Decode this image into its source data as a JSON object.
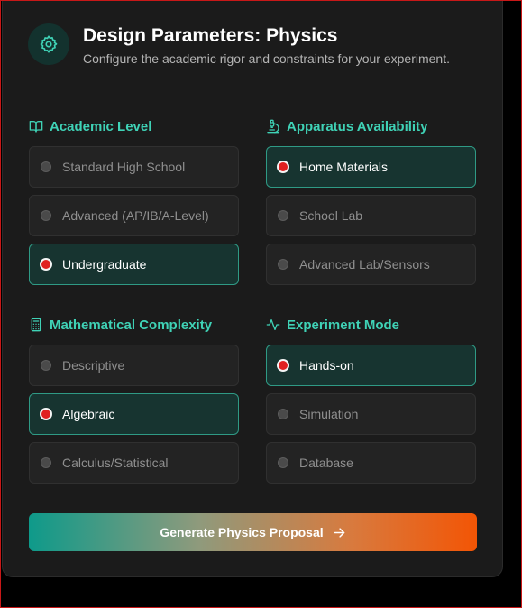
{
  "header": {
    "title": "Design Parameters: Physics",
    "subtitle": "Configure the academic rigor and constraints for your experiment.",
    "icon": "gear-icon"
  },
  "sections": [
    {
      "title": "Academic Level",
      "icon": "book-icon",
      "options": [
        {
          "label": "Standard High School",
          "selected": false
        },
        {
          "label": "Advanced (AP/IB/A-Level)",
          "selected": false
        },
        {
          "label": "Undergraduate",
          "selected": true
        }
      ]
    },
    {
      "title": "Apparatus Availability",
      "icon": "microscope-icon",
      "options": [
        {
          "label": "Home Materials",
          "selected": true
        },
        {
          "label": "School Lab",
          "selected": false
        },
        {
          "label": "Advanced Lab/Sensors",
          "selected": false
        }
      ]
    },
    {
      "title": "Mathematical Complexity",
      "icon": "calculator-icon",
      "options": [
        {
          "label": "Descriptive",
          "selected": false
        },
        {
          "label": "Algebraic",
          "selected": true
        },
        {
          "label": "Calculus/Statistical",
          "selected": false
        }
      ]
    },
    {
      "title": "Experiment Mode",
      "icon": "activity-icon",
      "options": [
        {
          "label": "Hands-on",
          "selected": true
        },
        {
          "label": "Simulation",
          "selected": false
        },
        {
          "label": "Database",
          "selected": false
        }
      ]
    }
  ],
  "generate_button": {
    "label": "Generate Physics Proposal",
    "icon": "arrow-right-icon"
  },
  "colors": {
    "accent": "#3fd2b6",
    "selected_radio": "#e02020",
    "gradient_start": "#0e9a8a",
    "gradient_end": "#f35505"
  }
}
